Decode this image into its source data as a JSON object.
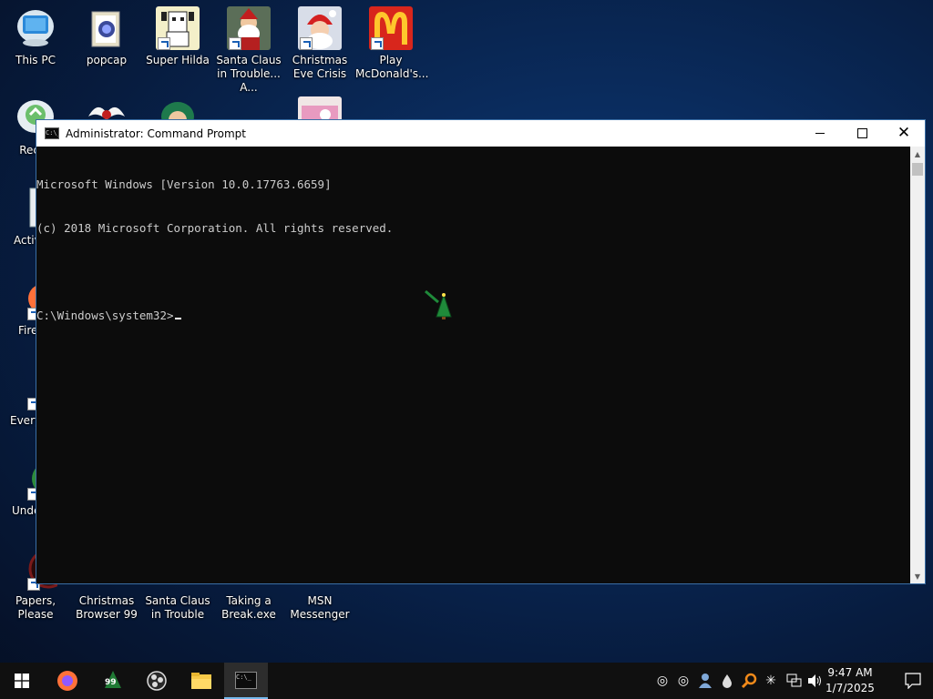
{
  "desktop": {
    "icons": [
      {
        "label": "This PC"
      },
      {
        "label": "popcap"
      },
      {
        "label": "Super Hilda"
      },
      {
        "label": "Santa Claus in Trouble... A..."
      },
      {
        "label": "Christmas Eve Crisis"
      },
      {
        "label": "Play McDonald's..."
      },
      {
        "label": "Recyc"
      },
      {
        "label": "Activ"
      },
      {
        "label": "Fire"
      },
      {
        "label": "Every"
      },
      {
        "label": "Unde"
      },
      {
        "label": "Papers, Please"
      },
      {
        "label": "Christmas Browser 99"
      },
      {
        "label": "Santa Claus in Trouble"
      },
      {
        "label": "Taking a Break.exe"
      },
      {
        "label": "MSN Messenger"
      }
    ]
  },
  "cmd": {
    "title": "Administrator: Command Prompt",
    "lines": [
      "Microsoft Windows [Version 10.0.17763.6659]",
      "(c) 2018 Microsoft Corporation. All rights reserved.",
      "",
      "C:\\Windows\\system32>"
    ]
  },
  "taskbar": {
    "time": "9:47 AM",
    "date": "1/7/2025",
    "badge_99": "99"
  },
  "colors": {
    "console_bg": "#0c0c0c",
    "console_text": "#cccccc",
    "taskbar_bg": "#101010",
    "accent": "#76b9ed"
  }
}
